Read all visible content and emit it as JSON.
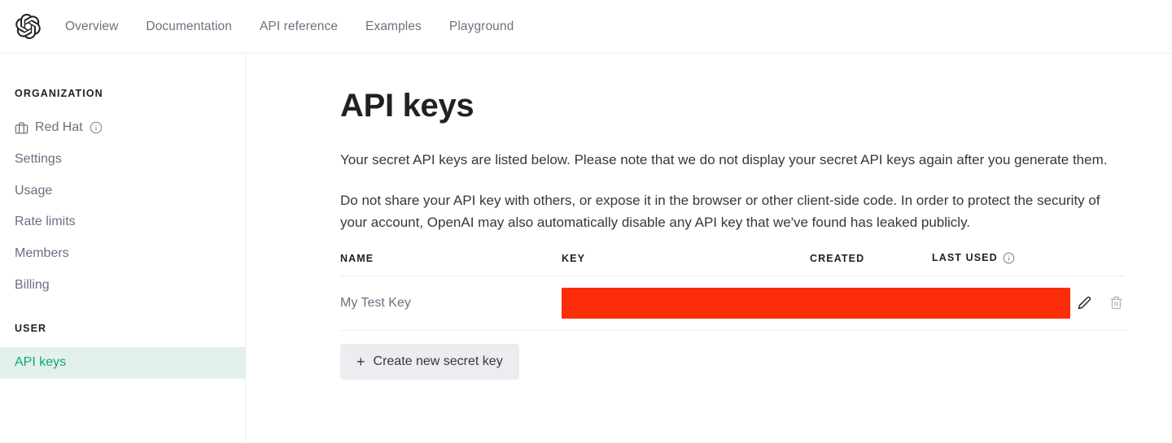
{
  "header": {
    "logo_icon": "openai-logo-icon",
    "nav": [
      {
        "label": "Overview"
      },
      {
        "label": "Documentation"
      },
      {
        "label": "API reference"
      },
      {
        "label": "Examples"
      },
      {
        "label": "Playground"
      }
    ]
  },
  "sidebar": {
    "organization": {
      "section_label": "ORGANIZATION",
      "org_name": "Red Hat",
      "org_icon": "briefcase-icon",
      "org_info_icon": "info-circle-icon",
      "items": [
        {
          "label": "Settings"
        },
        {
          "label": "Usage"
        },
        {
          "label": "Rate limits"
        },
        {
          "label": "Members"
        },
        {
          "label": "Billing"
        }
      ]
    },
    "user": {
      "section_label": "USER",
      "items": [
        {
          "label": "API keys",
          "active": true
        }
      ]
    },
    "active_bg": "#e3f1ec",
    "active_fg": "#10a37f"
  },
  "main": {
    "title": "API keys",
    "paragraphs": [
      "Your secret API keys are listed below. Please note that we do not display your secret API keys again after you generate them.",
      "Do not share your API key with others, or expose it in the browser or other client-side code. In order to protect the security of your account, OpenAI may also automatically disable any API key that we've found has leaked publicly."
    ],
    "table": {
      "columns": [
        {
          "label": "NAME"
        },
        {
          "label": "KEY"
        },
        {
          "label": "CREATED"
        },
        {
          "label": "LAST USED",
          "info_icon": "info-circle-icon"
        },
        {
          "label": ""
        }
      ],
      "rows": [
        {
          "name": "My Test Key",
          "key": "",
          "key_redacted": true,
          "key_redaction_color": "#fc2d08",
          "created": "",
          "last_used": "",
          "edit_icon": "pencil-icon",
          "delete_icon": "trash-icon"
        }
      ]
    },
    "create_button": {
      "icon": "plus-icon",
      "label": "Create new secret key"
    }
  }
}
